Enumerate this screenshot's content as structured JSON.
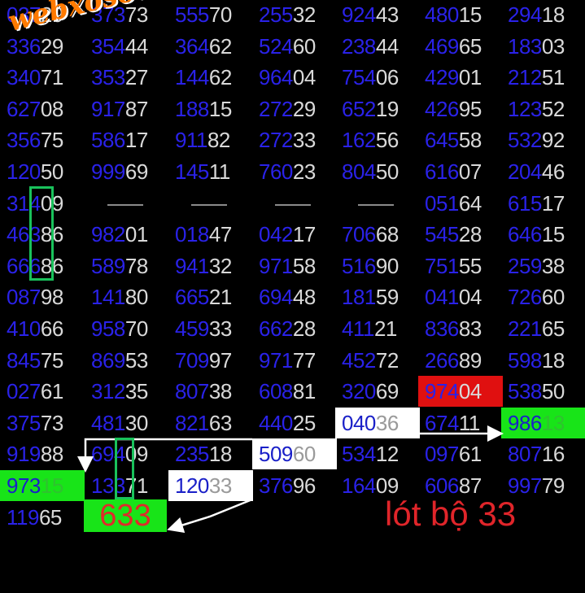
{
  "watermark": "webxoso.net",
  "caption": "lót bộ 33",
  "highlight_number": "633",
  "columns": [
    [
      "03729",
      "33629",
      "34071",
      "62708",
      "35675",
      "12050",
      "31409",
      "46386",
      "66686",
      "08798",
      "41066",
      "84575",
      "02761",
      "37573",
      "91988",
      "97315",
      "11965"
    ],
    [
      "37373",
      "35444",
      "35327",
      "91787",
      "58617",
      "99969",
      "----",
      "98201",
      "58978",
      "14180",
      "95870",
      "86953",
      "31235",
      "48130",
      "69409",
      "13371"
    ],
    [
      "55570",
      "36462",
      "14462",
      "18815",
      "91182",
      "14511",
      "----",
      "01847",
      "94132",
      "66521",
      "45933",
      "70997",
      "80738",
      "82163",
      "23518",
      "12033"
    ],
    [
      "25532",
      "52460",
      "96404",
      "27229",
      "27233",
      "76023",
      "----",
      "04217",
      "97158",
      "69448",
      "66228",
      "97177",
      "60881",
      "44025",
      "50960",
      "37696"
    ],
    [
      "92443",
      "23844",
      "75406",
      "65219",
      "16256",
      "80450",
      "----",
      "70668",
      "51690",
      "18159",
      "41121",
      "45272",
      "32069",
      "04036",
      "53412",
      "16409"
    ],
    [
      "48015",
      "46965",
      "42901",
      "42695",
      "64558",
      "61607",
      "05164",
      "54528",
      "75155",
      "04104",
      "83683",
      "26689",
      "97404",
      "67411",
      "09761",
      "60687"
    ],
    [
      "29418",
      "18303",
      "21251",
      "12352",
      "53292",
      "20446",
      "61517",
      "64615",
      "25938",
      "72660",
      "22165",
      "59818",
      "53850",
      "98613",
      "80716",
      "99779"
    ]
  ]
}
